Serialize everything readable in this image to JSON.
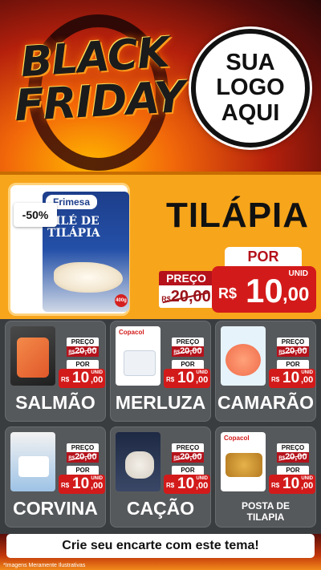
{
  "header": {
    "title_line1": "BLACK",
    "title_line2": "FRIDAY",
    "logo_line1": "SUA",
    "logo_line2": "LOGO",
    "logo_line3": "AQUI"
  },
  "featured": {
    "discount": "-50%",
    "brand": "Frimesa",
    "package_line1": "FILÉ DE",
    "package_line2": "TILÁPIA",
    "package_weight": "400g",
    "name": "TILÁPIA",
    "preco_label": "PREÇO",
    "old_currency": "R$",
    "old_price": "20,00",
    "por_label": "POR",
    "unid_label": "UNID",
    "new_currency": "R$",
    "new_int": "10",
    "new_dec": ",00"
  },
  "products": [
    {
      "name": "SALMÃO",
      "brand": "",
      "preco_label": "PREÇO",
      "old_currency": "R$",
      "old_price": "20,00",
      "por_label": "POR",
      "new_currency": "R$",
      "new_int": "10",
      "new_dec": ",00",
      "unid_label": "UNID"
    },
    {
      "name": "MERLUZA",
      "brand": "Copacol",
      "preco_label": "PREÇO",
      "old_currency": "R$",
      "old_price": "20,00",
      "por_label": "POR",
      "new_currency": "R$",
      "new_int": "10",
      "new_dec": ",00",
      "unid_label": "UNID"
    },
    {
      "name": "CAMARÃO",
      "brand": "",
      "preco_label": "PREÇO",
      "old_currency": "R$",
      "old_price": "20,00",
      "por_label": "POR",
      "new_currency": "R$",
      "new_int": "10",
      "new_dec": ",00",
      "unid_label": "UNID"
    },
    {
      "name": "CORVINA",
      "brand": "",
      "preco_label": "PREÇO",
      "old_currency": "R$",
      "old_price": "20,00",
      "por_label": "POR",
      "new_currency": "R$",
      "new_int": "10",
      "new_dec": ",00",
      "unid_label": "UNID"
    },
    {
      "name": "CAÇÃO",
      "brand": "",
      "preco_label": "PREÇO",
      "old_currency": "R$",
      "old_price": "20,00",
      "por_label": "POR",
      "new_currency": "R$",
      "new_int": "10",
      "new_dec": ",00",
      "unid_label": "UNID"
    },
    {
      "name_line1": "POSTA DE",
      "name_line2": "TILAPIA",
      "brand": "Copacol",
      "preco_label": "PREÇO",
      "old_currency": "R$",
      "old_price": "20,00",
      "por_label": "POR",
      "new_currency": "R$",
      "new_int": "10",
      "new_dec": ",00",
      "unid_label": "UNID"
    }
  ],
  "footer": {
    "cta": "Crie seu encarte com este tema!",
    "disclaimer": "*Imagens Meramente Ilustrativas"
  },
  "colors": {
    "featured_bg": "#f7a51b",
    "price_red": "#d31a1a",
    "dark_red": "#b5121b",
    "card_bg": "#56595c"
  }
}
